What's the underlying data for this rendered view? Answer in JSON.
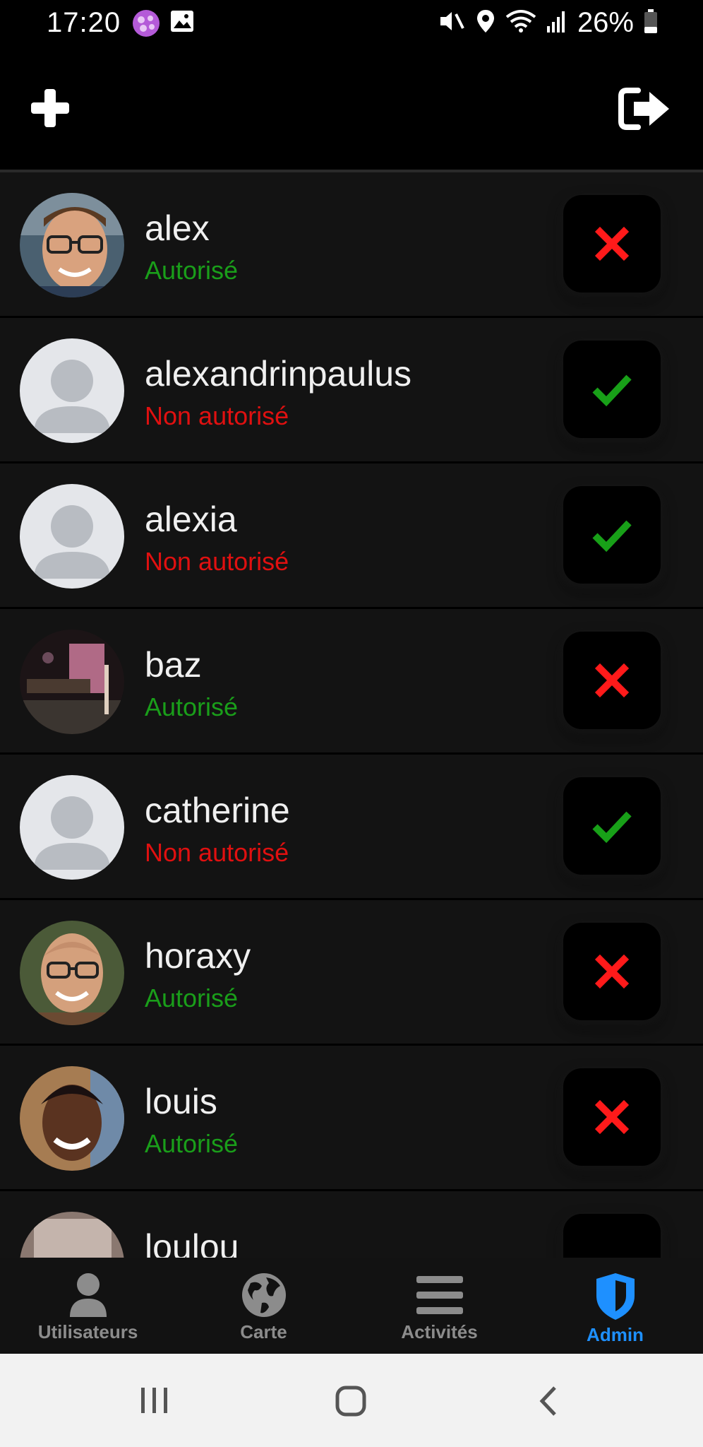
{
  "status_bar": {
    "time": "17:20",
    "battery": "26%",
    "icons": [
      "app-notification-icon",
      "gallery-icon",
      "mute-icon",
      "location-icon",
      "wifi-icon",
      "signal-icon",
      "battery-icon"
    ]
  },
  "app_bar": {
    "left_icon": "plus-icon",
    "right_icon": "logout-icon"
  },
  "users": [
    {
      "name": "alex",
      "status": "Autorisé",
      "authorized": true,
      "avatar": "photo"
    },
    {
      "name": "alexandrinpaulus",
      "status": "Non autorisé",
      "authorized": false,
      "avatar": "default"
    },
    {
      "name": "alexia",
      "status": "Non autorisé",
      "authorized": false,
      "avatar": "default"
    },
    {
      "name": "baz",
      "status": "Autorisé",
      "authorized": true,
      "avatar": "photo"
    },
    {
      "name": "catherine",
      "status": "Non autorisé",
      "authorized": false,
      "avatar": "default"
    },
    {
      "name": "horaxy",
      "status": "Autorisé",
      "authorized": true,
      "avatar": "photo"
    },
    {
      "name": "louis",
      "status": "Autorisé",
      "authorized": true,
      "avatar": "photo"
    },
    {
      "name": "loulou",
      "status": "",
      "authorized": false,
      "avatar": "photo"
    }
  ],
  "bottom_nav": {
    "items": [
      {
        "label": "Utilisateurs",
        "icon": "user-icon",
        "active": false
      },
      {
        "label": "Carte",
        "icon": "globe-icon",
        "active": false
      },
      {
        "label": "Activités",
        "icon": "menu-icon",
        "active": false
      },
      {
        "label": "Admin",
        "icon": "shield-icon",
        "active": true
      }
    ]
  },
  "colors": {
    "authorized": "#1a9e1a",
    "unauthorized": "#e01010",
    "accent": "#1e90ff",
    "background": "#121212"
  }
}
